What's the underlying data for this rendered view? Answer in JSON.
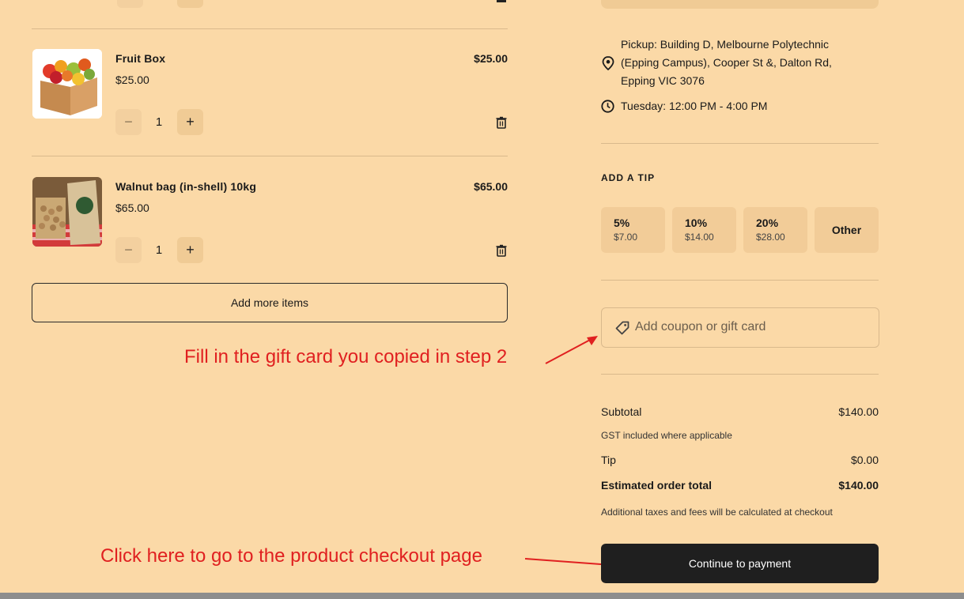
{
  "cart": {
    "items": [
      {
        "name": "Fruit Box",
        "unit_price": "$25.00",
        "total": "$25.00",
        "quantity": "1",
        "image": "fruit-box-photo"
      },
      {
        "name": "Walnut bag (in-shell) 10kg",
        "unit_price": "$65.00",
        "total": "$65.00",
        "quantity": "1",
        "image": "walnut-bag-photo"
      }
    ],
    "add_more_label": "Add more items"
  },
  "pickup": {
    "address": [
      "Pickup: Building D, Melbourne Polytechnic",
      "(Epping Campus), Cooper St &, Dalton Rd,",
      "Epping VIC 3076"
    ],
    "time": "Tuesday: 12:00 PM - 4:00 PM"
  },
  "tip": {
    "heading": "ADD A TIP",
    "options": [
      {
        "label": "5%",
        "amount": "$7.00"
      },
      {
        "label": "10%",
        "amount": "$14.00"
      },
      {
        "label": "20%",
        "amount": "$28.00"
      },
      {
        "label": "Other",
        "amount": ""
      }
    ]
  },
  "coupon": {
    "placeholder": "Add coupon or gift card"
  },
  "summary": {
    "subtotal_label": "Subtotal",
    "subtotal_value": "$140.00",
    "gst_note": "GST included where applicable",
    "tip_label": "Tip",
    "tip_value": "$0.00",
    "total_label": "Estimated order total",
    "total_value": "$140.00",
    "fees_note": "Additional taxes and fees will be calculated at checkout"
  },
  "checkout": {
    "button_label": "Continue to payment"
  },
  "annotations": {
    "gift_card": "Fill in the gift card you copied in step 2",
    "checkout": "Click here to go to the product checkout page"
  },
  "colors": {
    "background": "#fbd9a7",
    "button_dark": "#1f1f1f",
    "annotation_red": "#e02020"
  }
}
